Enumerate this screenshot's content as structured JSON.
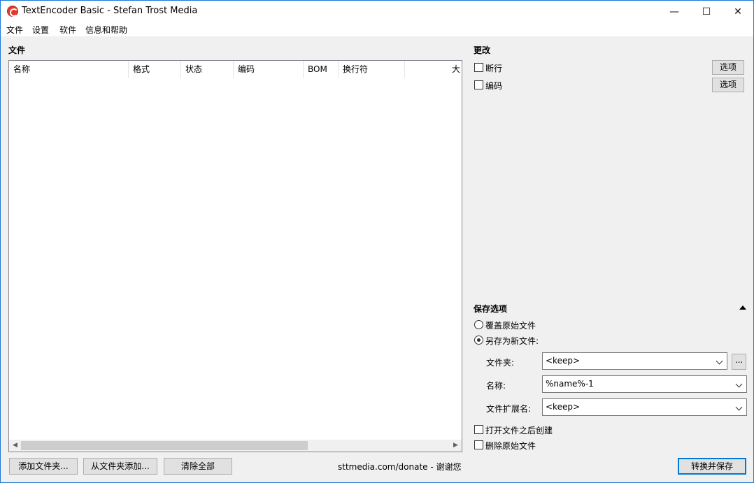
{
  "window": {
    "title": "TextEncoder Basic - Stefan Trost Media",
    "controls": {
      "minimize": "—",
      "maximize": "☐",
      "close": "✕"
    }
  },
  "menu": {
    "items": [
      "文件",
      "设置",
      "软件",
      "信息和帮助"
    ]
  },
  "files": {
    "heading": "文件",
    "columns": [
      "名称",
      "格式",
      "状态",
      "编码",
      "BOM",
      "换行符",
      "大"
    ],
    "rows": []
  },
  "changes": {
    "heading": "更改",
    "options": [
      {
        "label": "断行",
        "checked": false,
        "button": "选项"
      },
      {
        "label": "编码",
        "checked": false,
        "button": "选项"
      }
    ]
  },
  "save": {
    "heading": "保存选项",
    "overwrite_label": "覆盖原始文件",
    "saveas_label": "另存为新文件:",
    "selected": "saveas",
    "folder_label": "文件夹:",
    "folder_value": "<keep>",
    "browse_label": "...",
    "name_label": "名称:",
    "name_value": "%name%-1",
    "ext_label": "文件扩展名:",
    "ext_value": "<keep>",
    "open_after_label": "打开文件之后创建",
    "delete_original_label": "删除原始文件"
  },
  "bottom": {
    "add_folder": "添加文件夹...",
    "add_from_folder": "从文件夹添加...",
    "clear_all": "清除全部",
    "donate": "sttmedia.com/donate - 谢谢您",
    "convert_save": "转换并保存"
  },
  "colors": {
    "accent": "#0078d7",
    "window_border": "#1a7ad6",
    "background": "#f0f0f0"
  }
}
